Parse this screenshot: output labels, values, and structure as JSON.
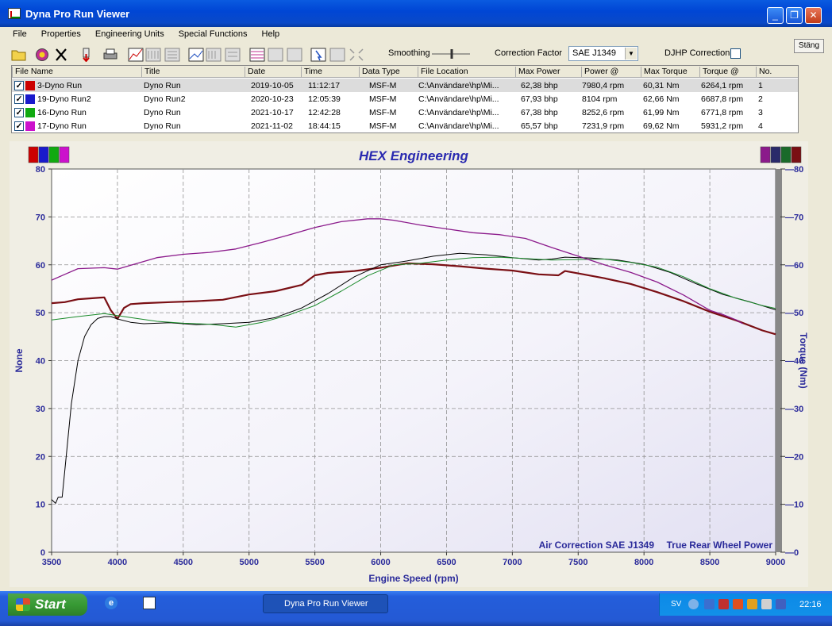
{
  "window": {
    "title": "Dyna Pro Run Viewer"
  },
  "menu": [
    "File",
    "Properties",
    "Engineering Units",
    "Special Functions",
    "Help"
  ],
  "toolbar": {
    "smoothing_label": "Smoothing",
    "correction_factor_label": "Correction Factor",
    "correction_factor_value": "SAE J1349",
    "djhp_label": "DJHP Correction",
    "djhp_checked": false,
    "close_label": "Stäng"
  },
  "table": {
    "columns": [
      "File Name",
      "Title",
      "Date",
      "Time",
      "Data Type",
      "File Location",
      "Max Power",
      "Power @",
      "Max Torque",
      "Torque @",
      "No."
    ],
    "rows": [
      {
        "file": "3-Dyno Run",
        "title": "Dyno Run",
        "date": "2019-10-05",
        "time": "11:12:17",
        "type": "MSF-M",
        "location": "C:\\Användare\\hp\\Mi...",
        "max_power": "62,38 bhp",
        "power_at": "7980,4 rpm",
        "max_torque": "60,31 Nm",
        "torque_at": "6264,1 rpm",
        "no": "1",
        "color": "#cc0000",
        "checked": true
      },
      {
        "file": "19-Dyno Run2",
        "title": "Dyno Run2",
        "date": "2020-10-23",
        "time": "12:05:39",
        "type": "MSF-M",
        "location": "C:\\Användare\\hp\\Mi...",
        "max_power": "67,93 bhp",
        "power_at": "8104 rpm",
        "max_torque": "62,66 Nm",
        "torque_at": "6687,8 rpm",
        "no": "2",
        "color": "#1a1acc",
        "checked": true
      },
      {
        "file": "16-Dyno Run",
        "title": "Dyno Run",
        "date": "2021-10-17",
        "time": "12:42:28",
        "type": "MSF-M",
        "location": "C:\\Användare\\hp\\Mi...",
        "max_power": "67,38 bhp",
        "power_at": "8252,6 rpm",
        "max_torque": "61,99 Nm",
        "torque_at": "6771,8 rpm",
        "no": "3",
        "color": "#11aa11",
        "checked": true
      },
      {
        "file": "17-Dyno Run",
        "title": "Dyno Run",
        "date": "2021-11-02",
        "time": "18:44:15",
        "type": "MSF-M",
        "location": "C:\\Användare\\hp\\Mi...",
        "max_power": "65,57 bhp",
        "power_at": "7231,9 rpm",
        "max_torque": "69,62 Nm",
        "torque_at": "5931,2 rpm",
        "no": "4",
        "color": "#cc11cc",
        "checked": true
      }
    ]
  },
  "chart_data": {
    "type": "line",
    "title": "HEX Engineering",
    "xlabel": "Engine Speed (rpm)",
    "ylabel": "None",
    "y2label": "Torque (Nm)",
    "xlim": [
      3500,
      9000
    ],
    "ylim": [
      0,
      80
    ],
    "y2lim": [
      0,
      80
    ],
    "xticks": [
      3500,
      4000,
      4500,
      5000,
      5500,
      6000,
      6500,
      7000,
      7500,
      8000,
      8500,
      9000
    ],
    "yticks": [
      0,
      10,
      20,
      30,
      40,
      50,
      60,
      70,
      80
    ],
    "grid": true,
    "annotations": [
      "Air Correction SAE J1349",
      "True Rear Wheel Power"
    ],
    "legend_left_colors": [
      "#cc0000",
      "#1a1acc",
      "#11aa11",
      "#cc11cc"
    ],
    "legend_right_colors": [
      "#8b1a8b",
      "#2a2a6a",
      "#1a6a2a",
      "#7a0f14"
    ],
    "series": [
      {
        "color": "#7a0f14",
        "width": 2.2,
        "x": [
          3500,
          3600,
          3700,
          3800,
          3900,
          3950,
          4000,
          4050,
          4100,
          4200,
          4400,
          4600,
          4800,
          5000,
          5200,
          5400,
          5500,
          5600,
          5800,
          6000,
          6200,
          6400,
          6600,
          6800,
          7000,
          7200,
          7350,
          7400,
          7500,
          7700,
          7900,
          8100,
          8300,
          8500,
          8700,
          8900,
          9000
        ],
        "y": [
          52,
          52.2,
          52.8,
          53,
          53.2,
          50.5,
          48.7,
          51,
          51.8,
          52,
          52.2,
          52.4,
          52.7,
          53.8,
          54.5,
          55.8,
          57.8,
          58.3,
          58.7,
          59.4,
          60.3,
          60.1,
          59.7,
          59.2,
          58.8,
          58,
          57.8,
          58.7,
          58.2,
          57.2,
          56,
          54.3,
          52.4,
          50.2,
          48.4,
          46.3,
          45.5
        ]
      },
      {
        "color": "#000000",
        "width": 1,
        "x": [
          3500,
          3530,
          3550,
          3580,
          3600,
          3650,
          3700,
          3750,
          3800,
          3850,
          3900,
          3950,
          4000,
          4100,
          4200,
          4400,
          4600,
          4800,
          5000,
          5200,
          5400,
          5600,
          5800,
          6000,
          6200,
          6400,
          6600,
          6800,
          7000,
          7200,
          7300,
          7400,
          7600,
          7800,
          8000,
          8200,
          8400,
          8600,
          8800,
          9000
        ],
        "y": [
          11,
          10.2,
          11.5,
          11.5,
          17,
          31,
          40,
          45,
          47.5,
          48.8,
          49.2,
          49.2,
          48.7,
          48,
          47.7,
          47.9,
          47.5,
          47.7,
          48,
          49,
          51,
          54,
          57.5,
          60,
          60.8,
          61.8,
          62.4,
          62.1,
          61.5,
          61,
          61.2,
          61.6,
          61.4,
          61,
          60.1,
          58.4,
          56,
          53.8,
          52.3,
          50.6
        ]
      },
      {
        "color": "#1a8a2a",
        "width": 1,
        "x": [
          3500,
          3700,
          3900,
          4100,
          4300,
          4500,
          4700,
          4900,
          5100,
          5300,
          5500,
          5700,
          5900,
          6100,
          6300,
          6500,
          6700,
          6900,
          7100,
          7300,
          7500,
          7700,
          7900,
          8100,
          8300,
          8500,
          8700,
          8900,
          9000
        ],
        "y": [
          48.5,
          49.2,
          49.8,
          49,
          48.2,
          47.8,
          47.6,
          47,
          48,
          49.5,
          51.5,
          54.5,
          57.7,
          60,
          60.3,
          61,
          61.5,
          61.6,
          61.3,
          61,
          61.1,
          61.2,
          60.5,
          59.5,
          57.5,
          55,
          53,
          51.5,
          50.9
        ]
      },
      {
        "color": "#8b1a8b",
        "width": 1.3,
        "x": [
          3500,
          3600,
          3700,
          3800,
          3900,
          4000,
          4100,
          4300,
          4500,
          4700,
          4900,
          5100,
          5300,
          5500,
          5700,
          5900,
          6000,
          6100,
          6300,
          6500,
          6700,
          6900,
          7100,
          7300,
          7500,
          7700,
          7900,
          8100,
          8300,
          8500,
          8600,
          8700,
          8750
        ],
        "y": [
          56.8,
          58,
          59.2,
          59.3,
          59.4,
          59.1,
          59.9,
          61.5,
          62.2,
          62.6,
          63.3,
          64.7,
          66.2,
          67.8,
          69,
          69.6,
          69.6,
          69.3,
          68.3,
          67.5,
          66.7,
          66.3,
          65.5,
          63.6,
          61.8,
          60,
          58.4,
          56.4,
          53.7,
          50.5,
          49.6,
          48.5,
          47.7
        ]
      }
    ]
  }
}
